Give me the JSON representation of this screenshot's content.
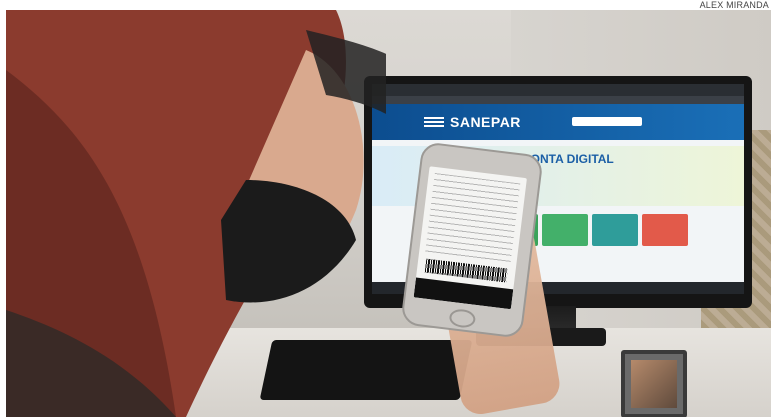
{
  "photo_credit": "ALEX MIRANDA",
  "screen": {
    "site_logo": "SANEPAR",
    "banner_title": "CONTA DIGITAL"
  },
  "colors": {
    "sanepar_blue": "#1a6fb7",
    "hair_red": "#8b3b2e",
    "tile_green": "#3aa35b",
    "tile_red": "#e25a4a"
  }
}
